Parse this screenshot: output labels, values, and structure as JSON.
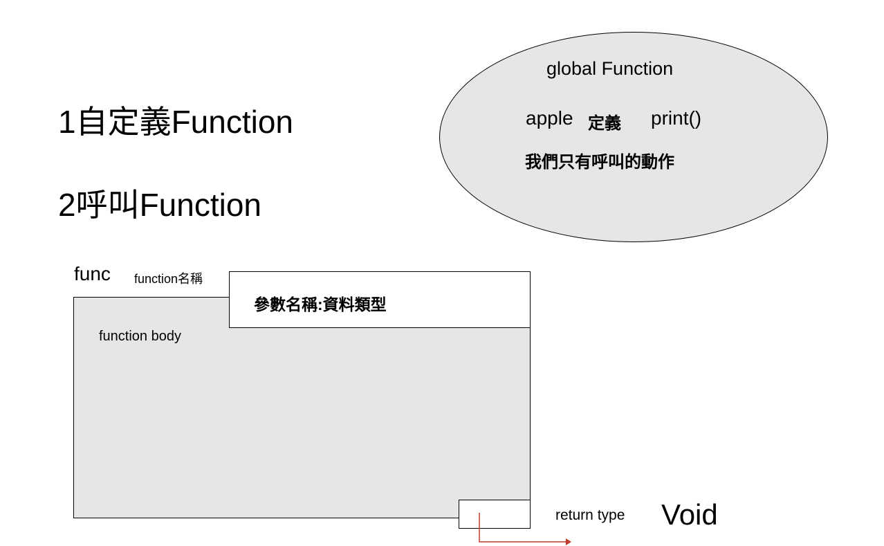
{
  "headings": {
    "line1": "1自定義Function",
    "line2": "2呼叫Function"
  },
  "global_bubble": {
    "title": "global Function",
    "example_name": "apple",
    "example_define": "定義",
    "example_call": "print()",
    "note": "我們只有呼叫的動作"
  },
  "function_diagram": {
    "keyword": "func",
    "name_label": "function名稱",
    "param_label": "參數名稱:資料類型",
    "body_label": "function body",
    "return_type_label": "return type",
    "return_type_value": "Void"
  },
  "colors": {
    "fill_gray": "#e6e6e6",
    "stroke": "#000000",
    "arrow": "#c0392b"
  }
}
